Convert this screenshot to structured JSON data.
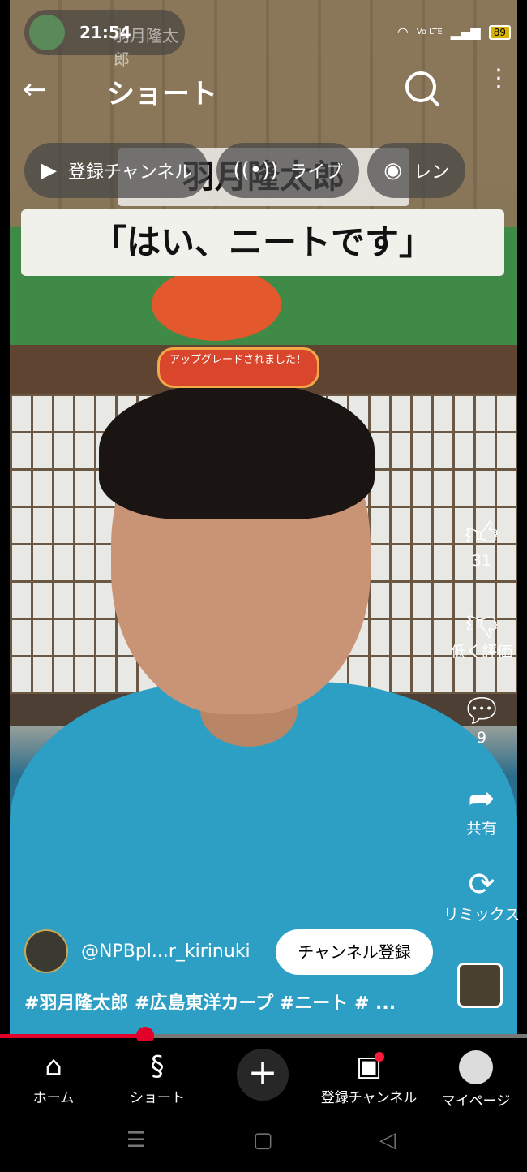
{
  "status_bar": {
    "time": "21:54",
    "channel_overlay": "羽月隆太郎",
    "battery": "89",
    "network": "Vo LTE"
  },
  "header": {
    "title": "ショート"
  },
  "chips": [
    {
      "icon": "subscriptions-icon",
      "label": "登録チャンネル"
    },
    {
      "icon": "live-icon",
      "label": "ライブ"
    },
    {
      "icon": "lens-icon",
      "label": "レン"
    }
  ],
  "video": {
    "caption_top": "羽月隆太郎",
    "caption_main": "「はい、ニートです」",
    "upgrade_badge": "アップグレードされました！"
  },
  "actions": {
    "like_count": "31",
    "dislike_label": "低く評価",
    "comment_count": "9",
    "share_label": "共有",
    "remix_label": "リミックス"
  },
  "channel": {
    "handle": "@NPBpl...r_kirinuki",
    "subscribe_label": "チャンネル登録"
  },
  "description": "#羽月隆太郎 #広島東洋カープ #ニート # ...",
  "progress": {
    "fraction": 0.276
  },
  "bottom_nav": [
    {
      "icon": "home-icon",
      "label": "ホーム"
    },
    {
      "icon": "shorts-icon",
      "label": "ショート"
    },
    {
      "icon": "create-icon",
      "label": ""
    },
    {
      "icon": "subscriptions-icon",
      "label": "登録チャンネル"
    },
    {
      "icon": "avatar-icon",
      "label": "マイページ"
    }
  ]
}
